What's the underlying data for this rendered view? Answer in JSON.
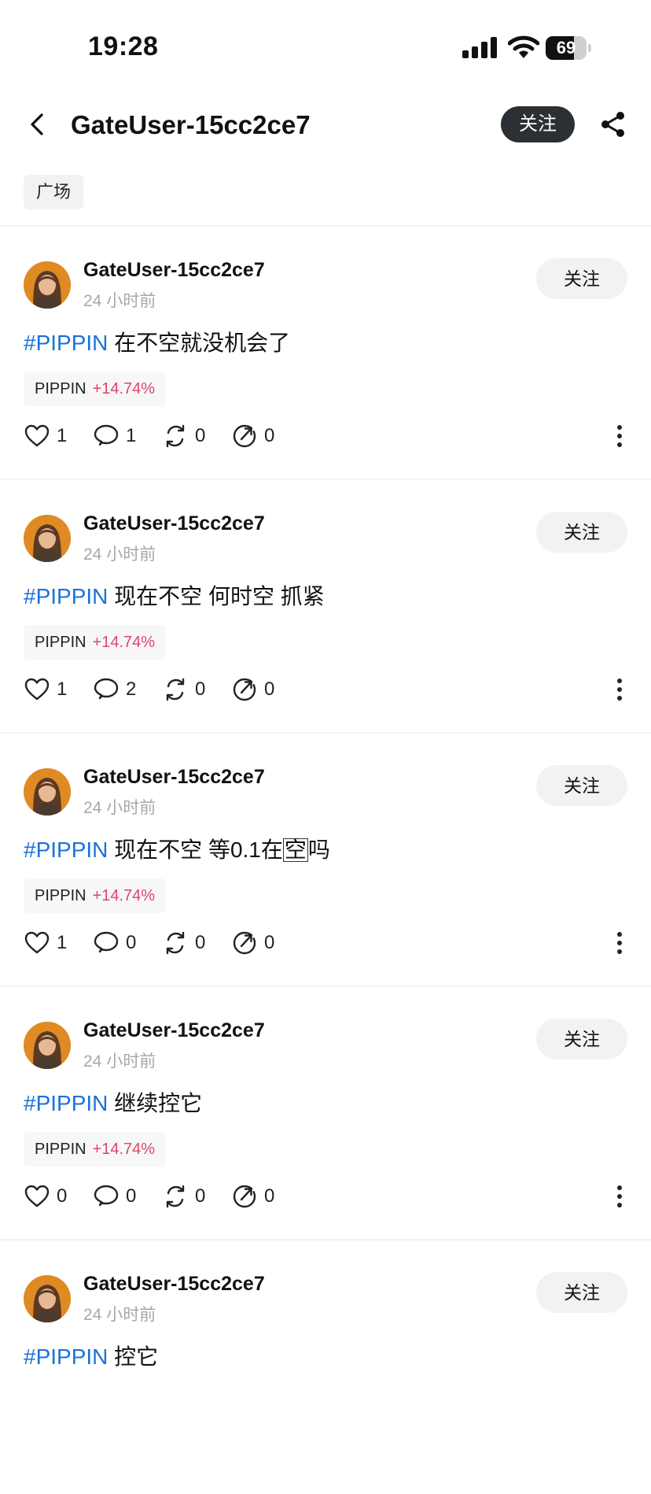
{
  "status_bar": {
    "time": "19:28",
    "battery": "69",
    "battery_level": 0.69
  },
  "header": {
    "title": "GateUser-15cc2ce7",
    "follow_label": "关注"
  },
  "tabs": [
    {
      "label": "广场"
    }
  ],
  "posts": [
    {
      "username": "GateUser-15cc2ce7",
      "time": "24 小时前",
      "follow_label": "关注",
      "hashtag": "#PIPPIN",
      "text": "在不空就没机会了",
      "text_pre": "",
      "text_boxed": "",
      "text_post": "",
      "coin": "PIPPIN",
      "coin_change": "+14.74%",
      "likes": "1",
      "comments": "1",
      "reposts": "0",
      "shares": "0"
    },
    {
      "username": "GateUser-15cc2ce7",
      "time": "24 小时前",
      "follow_label": "关注",
      "hashtag": "#PIPPIN",
      "text": "现在不空 何时空 抓紧",
      "text_pre": "",
      "text_boxed": "",
      "text_post": "",
      "coin": "PIPPIN",
      "coin_change": "+14.74%",
      "likes": "1",
      "comments": "2",
      "reposts": "0",
      "shares": "0"
    },
    {
      "username": "GateUser-15cc2ce7",
      "time": "24 小时前",
      "follow_label": "关注",
      "hashtag": "#PIPPIN",
      "text": "",
      "text_pre": "现在不空 等0.1在",
      "text_boxed": "空",
      "text_post": "吗",
      "coin": "PIPPIN",
      "coin_change": "+14.74%",
      "likes": "1",
      "comments": "0",
      "reposts": "0",
      "shares": "0"
    },
    {
      "username": "GateUser-15cc2ce7",
      "time": "24 小时前",
      "follow_label": "关注",
      "hashtag": "#PIPPIN",
      "text": "继续控它",
      "text_pre": "",
      "text_boxed": "",
      "text_post": "",
      "coin": "PIPPIN",
      "coin_change": "+14.74%",
      "likes": "0",
      "comments": "0",
      "reposts": "0",
      "shares": "0"
    },
    {
      "username": "GateUser-15cc2ce7",
      "time": "24 小时前",
      "follow_label": "关注",
      "hashtag": "#PIPPIN",
      "text": "控它",
      "text_pre": "",
      "text_boxed": "",
      "text_post": ""
    }
  ],
  "icons": {
    "back": "chevron-left-icon",
    "share": "share-icon",
    "like": "heart-icon",
    "comment": "comment-icon",
    "repost": "repost-icon",
    "forward": "forward-icon",
    "more": "more-vertical-icon"
  },
  "colors": {
    "hashtag": "#1a73d9",
    "gain": "#e0456b",
    "follow_button_dark": "#2c2f33"
  }
}
